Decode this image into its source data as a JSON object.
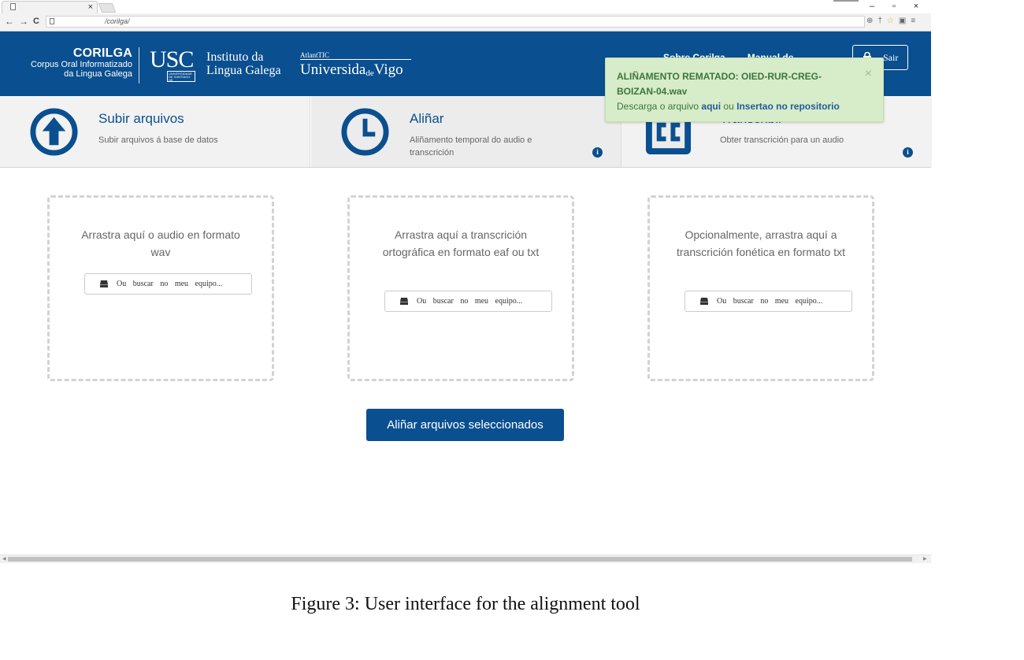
{
  "browser": {
    "tab_close": "×",
    "url": "/corilga/",
    "back": "←",
    "forward": "→",
    "reload": "C",
    "window_controls": [
      "–",
      "▫",
      "×"
    ],
    "zoom_icon": "⊕",
    "key_icon": "†",
    "star_icon": "☆",
    "ext_icon": "▣",
    "menu_icon": "≡"
  },
  "header": {
    "brand": "CORILGA",
    "brand_sub_1": "Corpus Oral Informatizado",
    "brand_sub_2": "da Lingua Galega",
    "usc_letters": "USC",
    "usc_small": "UNIVERSIDADE DE SANTIAGO DE COMPOSTELA",
    "ilg_line_1": "Instituto da",
    "ilg_line_2": "Lingua Galega",
    "atlantic_small": "AtlantTIC",
    "uvigo_a": "Universida",
    "uvigo_de": "de",
    "uvigo_b": "Vigo",
    "nav_items": [
      "Sobre Corilga",
      "Manual de"
    ],
    "logout_label": "Sair"
  },
  "features": [
    {
      "title": "Subir arquivos",
      "desc": "Subir arquivos á base de datos",
      "icon": "upload-arrow-icon"
    },
    {
      "title": "Aliñar",
      "desc": "Aliñamento temporal do audio e transcrición",
      "icon": "clock-icon"
    },
    {
      "title": "Transcribir",
      "desc": "Obter transcrición para un audio",
      "icon": "closed-captions-icon"
    }
  ],
  "info_glyph": "i",
  "alert": {
    "title": "ALIÑAMENTO REMATADO: OIED-RUR-CREG-BOIZAN-04.wav",
    "body_prefix": "Descarga o arquivo",
    "link_here": "aqui",
    "body_middle": "ou",
    "link_repo": "Insertao no repositorio",
    "close": "×"
  },
  "dropzones": [
    {
      "text": "Arrastra aquí o audio en formato wav",
      "button": "Ou buscar no meu equipo..."
    },
    {
      "text": "Arrastra aquí a transcrición ortográfica en formato eaf ou txt",
      "button": "Ou buscar no meu equipo..."
    },
    {
      "text": "Opcionalmente, arrastra aquí a transcrición fonética en formato txt",
      "button": "Ou buscar no meu equipo..."
    }
  ],
  "align_button": "Aliñar arquivos seleccionados",
  "caption": "Figure 3: User interface for the alignment tool",
  "colors": {
    "brand_blue": "#0a4f8f",
    "alert_green_bg": "#d7ecc9",
    "alert_green_text": "#3c763d"
  }
}
